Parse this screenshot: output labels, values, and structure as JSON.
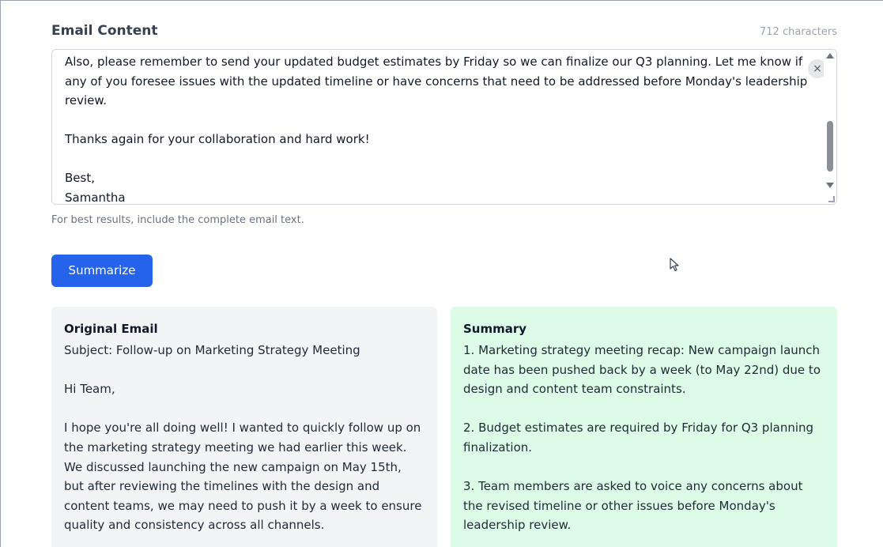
{
  "email_input": {
    "label": "Email Content",
    "char_count": "712 characters",
    "visible_text": "Also, please remember to send your updated budget estimates by Friday so we can finalize our Q3 planning. Let me know if any of you foresee issues with the updated timeline or have concerns that need to be addressed before Monday's leadership review.\n\nThanks again for your collaboration and hard work!\n\nBest,\nSamantha",
    "clear_icon": "×",
    "help_text": "For best results, include the complete email text."
  },
  "actions": {
    "summarize_label": "Summarize"
  },
  "original_panel": {
    "title": "Original Email",
    "body": "Subject: Follow-up on Marketing Strategy Meeting\n\nHi Team,\n\nI hope you're all doing well! I wanted to quickly follow up on the marketing strategy meeting we had earlier this week. We discussed launching the new campaign on May 15th, but after reviewing the timelines with the design and content teams, we may need to push it by a week to ensure quality and consistency across all channels."
  },
  "summary_panel": {
    "title": "Summary",
    "body": "1. Marketing strategy meeting recap: New campaign launch date has been pushed back by a week (to May 22nd) due to design and content team constraints.\n\n2. Budget estimates are required by Friday for Q3 planning finalization.\n\n3. Team members are asked to voice any concerns about the revised timeline or other issues before Monday's leadership review."
  },
  "colors": {
    "primary": "#2563eb",
    "original_bg": "#f3f4f6",
    "summary_bg": "#dcfce7"
  },
  "icons": {
    "clear": "close-icon",
    "cursor": "mouse-pointer-icon"
  }
}
